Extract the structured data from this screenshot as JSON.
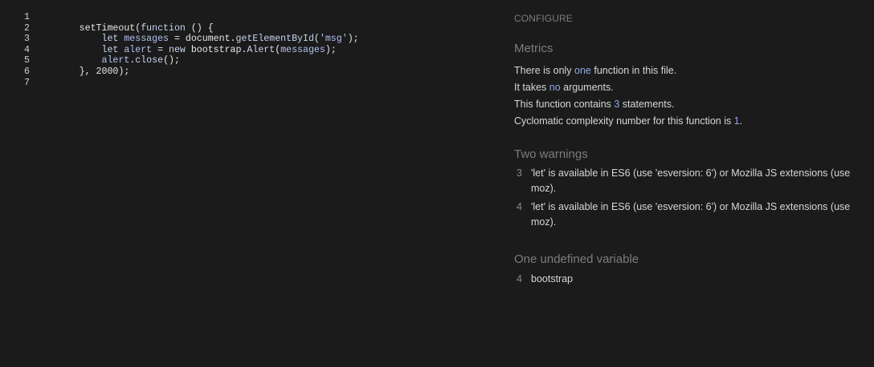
{
  "editor": {
    "lines": [
      {
        "num": "1",
        "parts": []
      },
      {
        "num": "2",
        "parts": [
          {
            "t": "        setTimeout(",
            "c": "tk-default"
          },
          {
            "t": "function",
            "c": "tk-soft"
          },
          {
            "t": " () {",
            "c": "tk-default"
          }
        ]
      },
      {
        "num": "3",
        "parts": [
          {
            "t": "            ",
            "c": "tk-default"
          },
          {
            "t": "let",
            "c": "tk-soft"
          },
          {
            "t": " ",
            "c": "tk-default"
          },
          {
            "t": "messages",
            "c": "tk-ident"
          },
          {
            "t": " = document.",
            "c": "tk-default"
          },
          {
            "t": "getElementById",
            "c": "tk-soft"
          },
          {
            "t": "(",
            "c": "tk-default"
          },
          {
            "t": "'msg'",
            "c": "tk-string"
          },
          {
            "t": ");",
            "c": "tk-default"
          }
        ]
      },
      {
        "num": "4",
        "parts": [
          {
            "t": "            ",
            "c": "tk-default"
          },
          {
            "t": "let",
            "c": "tk-soft"
          },
          {
            "t": " ",
            "c": "tk-default"
          },
          {
            "t": "alert",
            "c": "tk-ident"
          },
          {
            "t": " = ",
            "c": "tk-default"
          },
          {
            "t": "new",
            "c": "tk-soft"
          },
          {
            "t": " bootstrap.",
            "c": "tk-default"
          },
          {
            "t": "Alert",
            "c": "tk-soft"
          },
          {
            "t": "(",
            "c": "tk-default"
          },
          {
            "t": "messages",
            "c": "tk-ident"
          },
          {
            "t": ");",
            "c": "tk-default"
          }
        ]
      },
      {
        "num": "5",
        "parts": [
          {
            "t": "            ",
            "c": "tk-default"
          },
          {
            "t": "alert",
            "c": "tk-ident"
          },
          {
            "t": ".",
            "c": "tk-default"
          },
          {
            "t": "close",
            "c": "tk-soft"
          },
          {
            "t": "();",
            "c": "tk-default"
          }
        ]
      },
      {
        "num": "6",
        "parts": [
          {
            "t": "        }, 2000);",
            "c": "tk-default"
          }
        ]
      },
      {
        "num": "7",
        "parts": []
      }
    ]
  },
  "panel": {
    "configure_label": "CONFIGURE",
    "metrics": {
      "title": "Metrics",
      "line1": {
        "pre": "There is only ",
        "hl": "one",
        "post": " function in this file."
      },
      "line2": {
        "pre": "It takes ",
        "hl": "no",
        "post": " arguments."
      },
      "line3": {
        "pre": "This function contains ",
        "hl": "3",
        "post": " statements."
      },
      "line4": {
        "pre": "Cyclomatic complexity number for this function is ",
        "hl": "1",
        "post": "."
      }
    },
    "warnings": {
      "title": "Two warnings",
      "items": [
        {
          "line": "3",
          "text": "'let' is available in ES6 (use 'esversion: 6') or Mozilla JS extensions (use moz)."
        },
        {
          "line": "4",
          "text": "'let' is available in ES6 (use 'esversion: 6') or Mozilla JS extensions (use moz)."
        }
      ]
    },
    "undefined": {
      "title": "One undefined variable",
      "items": [
        {
          "line": "4",
          "name": "bootstrap"
        }
      ]
    }
  }
}
